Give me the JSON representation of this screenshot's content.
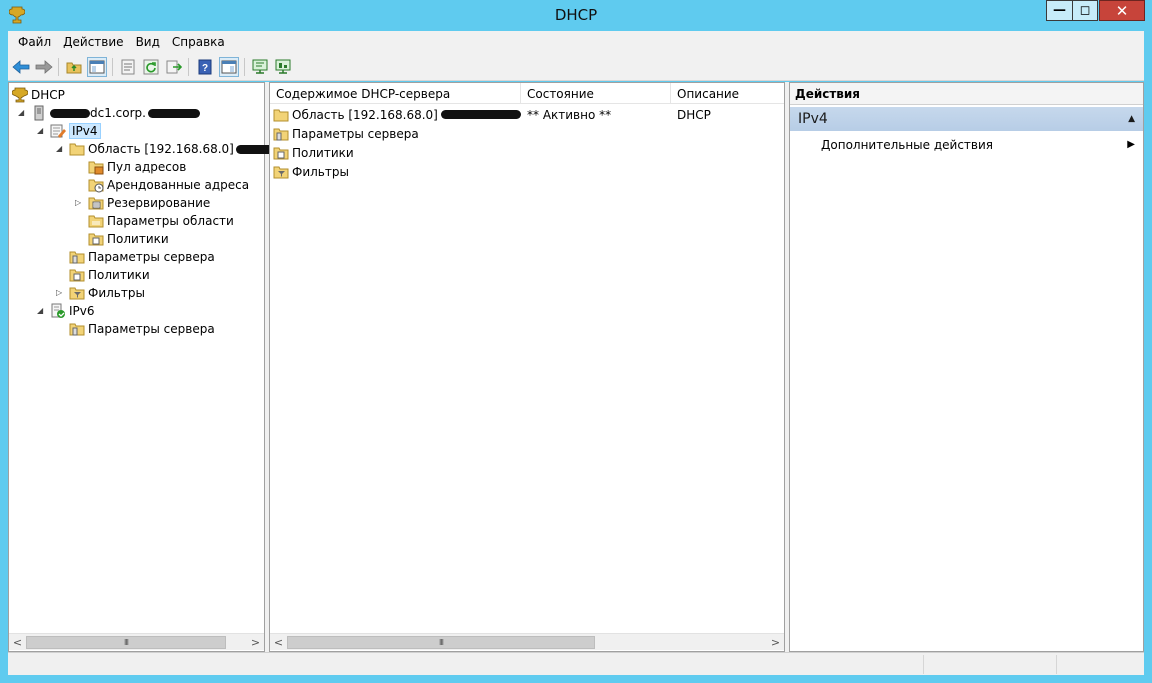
{
  "window": {
    "title": "DHCP",
    "minimize": "—",
    "maximize": "◻",
    "close": "✕"
  },
  "menu": [
    "Файл",
    "Действие",
    "Вид",
    "Справка"
  ],
  "tree": {
    "root": "DHCP",
    "server": "dc1.corp.",
    "ipv4": "IPv4",
    "scope": "Область [192.168.68.0]",
    "address_pool": "Пул адресов",
    "leases": "Арендованные адреса",
    "reservations": "Резервирование",
    "scope_options": "Параметры области",
    "scope_policies": "Политики",
    "server_options": "Параметры сервера",
    "policies": "Политики",
    "filters": "Фильтры",
    "ipv6": "IPv6",
    "ipv6_server_options": "Параметры сервера"
  },
  "list": {
    "columns": [
      "Содержимое DHCP-сервера",
      "Состояние",
      "Описание"
    ],
    "rows": [
      {
        "name": "Область [192.168.68.0]",
        "state": "** Активно **",
        "desc": "DHCP"
      },
      {
        "name": "Параметры сервера",
        "state": "",
        "desc": ""
      },
      {
        "name": "Политики",
        "state": "",
        "desc": ""
      },
      {
        "name": "Фильтры",
        "state": "",
        "desc": ""
      }
    ]
  },
  "actions": {
    "header": "Действия",
    "section": "IPv4",
    "more_actions": "Дополнительные действия"
  },
  "scroll": {
    "left_arrow": "<",
    "right_arrow": ">",
    "grip": "III"
  },
  "colors": {
    "window_frame": "#5fcbef",
    "selection": "#cce8ff",
    "actions_section": "#c6d8ec",
    "close_button": "#c7443a"
  }
}
